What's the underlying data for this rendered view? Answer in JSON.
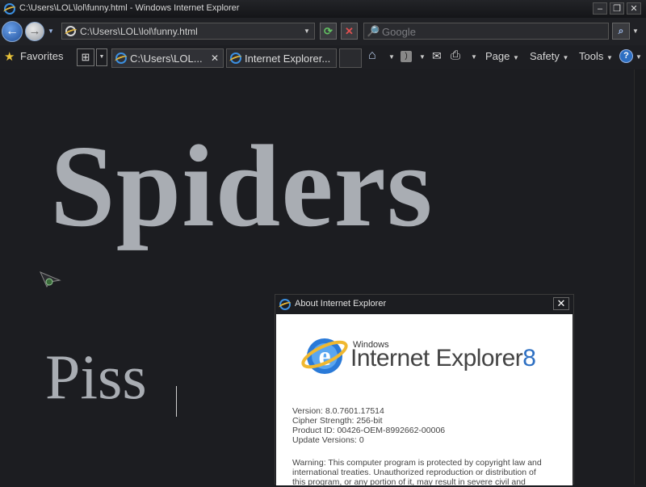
{
  "window": {
    "title": "C:\\Users\\LOL\\lol\\funny.html - Windows Internet Explorer",
    "controls": {
      "minimize": "–",
      "restore": "❐",
      "close": "✕"
    }
  },
  "address": {
    "value": "C:\\Users\\LOL\\lol\\funny.html"
  },
  "search": {
    "placeholder": "Google"
  },
  "toolbar": {
    "favorites_label": "Favorites",
    "page_label": "Page",
    "safety_label": "Safety",
    "tools_label": "Tools"
  },
  "tabs": [
    {
      "label": "C:\\Users\\LOL..."
    },
    {
      "label": "Internet Explorer..."
    }
  ],
  "page": {
    "heading": "Spiders",
    "subtext": "Piss"
  },
  "dialog": {
    "title": "About Internet Explorer",
    "brand_top": "Windows",
    "brand_name": "Internet Explorer",
    "brand_version": "8",
    "version_line": "Version: 8.0.7601.17514",
    "cipher_line": "Cipher Strength: 256-bit",
    "product_line": "Product ID: 00426-OEM-8992662-00006",
    "update_line": "Update Versions: 0",
    "warning_line1": "Warning: This computer program is protected by copyright law and",
    "warning_line2": "international treaties. Unauthorized reproduction or distribution of",
    "warning_line3": "this program, or any portion of it, may result in severe civil and"
  },
  "colors": {
    "background": "#1c1d21",
    "text_gray": "#a9adb3",
    "accent_blue": "#2d6fc2"
  }
}
